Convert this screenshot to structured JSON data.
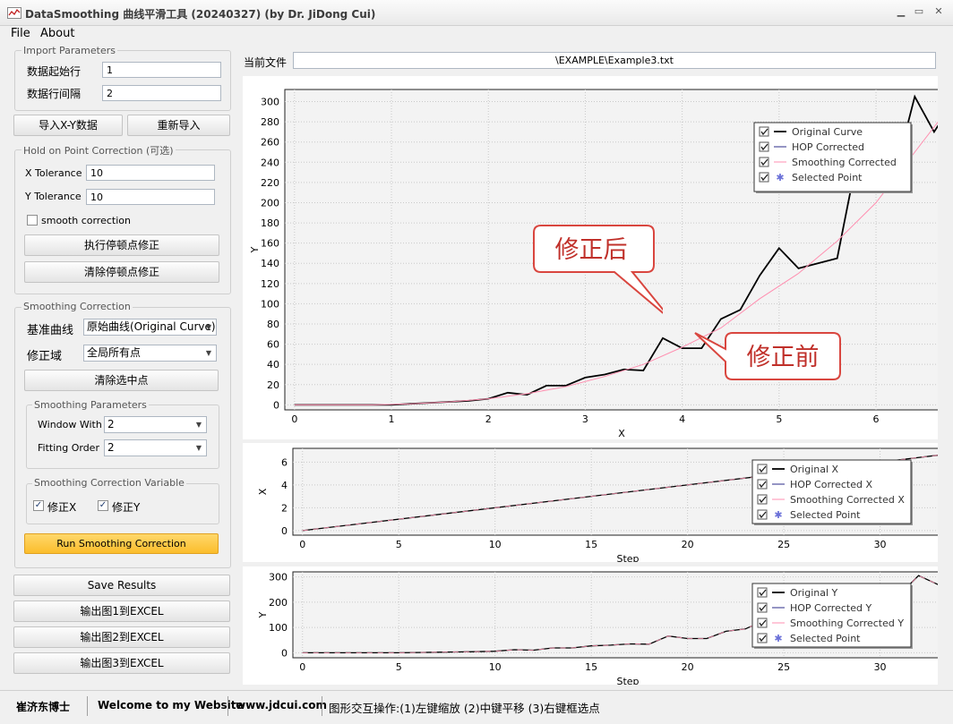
{
  "window": {
    "title": "DataSmoothing 曲线平滑工具 (20240327) (by Dr. JiDong Cui)"
  },
  "menu": [
    "File",
    "About"
  ],
  "import_params": {
    "legend": "Import Parameters",
    "start_row_label": "数据起始行",
    "start_row_value": "1",
    "interval_label": "数据行间隔",
    "interval_value": "2"
  },
  "buttons": {
    "import_xy": "导入X-Y数据",
    "reimport": "重新导入"
  },
  "hold_on": {
    "legend": "Hold on Point Correction (可选)",
    "x_tol_label": "X Tolerance",
    "x_tol_value": "10",
    "y_tol_label": "Y Tolerance",
    "y_tol_value": "10",
    "smooth_label": "smooth correction",
    "smooth_checked": false,
    "exec_button": "执行停顿点修正",
    "clear_button": "清除停顿点修正"
  },
  "smoothing": {
    "legend": "Smoothing Correction",
    "base_label": "基准曲线",
    "base_value": "原始曲线(Original Curve)",
    "domain_label": "修正域",
    "domain_value": "全局所有点",
    "clear_selected": "清除选中点",
    "params_legend": "Smoothing Parameters",
    "window_label": "Window With",
    "window_value": "2",
    "order_label": "Fitting Order",
    "order_value": "2",
    "variable_legend": "Smoothing Correction Variable",
    "fix_x": "修正X",
    "fix_y": "修正Y",
    "run_button": "Run Smoothing Correction"
  },
  "output": {
    "save": "Save Results",
    "out1": "输出图1到EXCEL",
    "out2": "输出图2到EXCEL",
    "out3": "输出图3到EXCEL"
  },
  "current_file": {
    "label": "当前文件",
    "value": "\\EXAMPLE\\Example3.txt"
  },
  "callouts": {
    "after": "修正后",
    "before": "修正前"
  },
  "colors": {
    "original": "#000000",
    "hop": "#2b2b8a",
    "smooth": "#ff8fb0",
    "selected": "#6a70d8",
    "run_button": "#fcc43a"
  },
  "chart_data": [
    {
      "type": "line",
      "xlabel": "X",
      "ylabel": "Y",
      "xlim": [
        -0.1,
        6.85
      ],
      "ylim": [
        -5,
        312
      ],
      "xticks": [
        0,
        1,
        2,
        3,
        4,
        5,
        6
      ],
      "yticks": [
        0,
        20,
        40,
        60,
        80,
        100,
        120,
        140,
        160,
        180,
        200,
        220,
        240,
        260,
        280,
        300
      ],
      "legend": [
        "Original Curve",
        "HOP Corrected",
        "Smoothing Corrected",
        "Selected Point"
      ],
      "series": [
        {
          "name": "Original Curve",
          "x": [
            0,
            0.2,
            0.4,
            0.6,
            0.8,
            1.0,
            1.2,
            1.4,
            1.6,
            1.8,
            2.0,
            2.2,
            2.4,
            2.6,
            2.8,
            3.0,
            3.2,
            3.4,
            3.6,
            3.8,
            4.0,
            4.2,
            4.4,
            4.6,
            4.8,
            5.0,
            5.2,
            5.4,
            5.6,
            5.8,
            6.0,
            6.2,
            6.4,
            6.6,
            6.8
          ],
          "y": [
            0,
            0,
            0,
            0,
            0,
            0,
            1,
            2,
            3,
            4,
            6,
            12,
            10,
            19,
            19,
            27,
            30,
            35,
            34,
            66,
            56,
            56,
            85,
            94,
            128,
            155,
            135,
            140,
            145,
            242,
            241,
            230,
            305,
            270,
            300
          ]
        },
        {
          "name": "Smoothing Corrected",
          "x": [
            0,
            0.4,
            0.8,
            1.2,
            1.6,
            2.0,
            2.4,
            2.8,
            3.2,
            3.6,
            4.0,
            4.4,
            4.8,
            5.2,
            5.6,
            6.0,
            6.4,
            6.8
          ],
          "y": [
            0,
            0,
            0,
            1,
            3,
            6,
            11,
            18,
            28,
            40,
            57,
            76,
            105,
            130,
            162,
            200,
            250,
            300
          ]
        }
      ]
    },
    {
      "type": "line",
      "xlabel": "Step",
      "ylabel": "X",
      "xlim": [
        -0.5,
        34.3
      ],
      "ylim": [
        -0.4,
        7.2
      ],
      "xticks": [
        0,
        5,
        10,
        15,
        20,
        25,
        30
      ],
      "yticks": [
        0,
        2,
        4,
        6
      ],
      "legend": [
        "Original X",
        "HOP Corrected X",
        "Smoothing Corrected X",
        "Selected Point"
      ],
      "series": [
        {
          "name": "Original X",
          "x": [
            0,
            34
          ],
          "y": [
            0,
            6.8
          ]
        }
      ]
    },
    {
      "type": "line",
      "xlabel": "Step",
      "ylabel": "Y",
      "xlim": [
        -0.5,
        34.3
      ],
      "ylim": [
        -20,
        320
      ],
      "xticks": [
        0,
        5,
        10,
        15,
        20,
        25,
        30
      ],
      "yticks": [
        0,
        100,
        200,
        300
      ],
      "legend": [
        "Original Y",
        "HOP Corrected Y",
        "Smoothing Corrected Y",
        "Selected Point"
      ],
      "series": [
        {
          "name": "Original Y",
          "x": [
            0,
            1,
            2,
            3,
            4,
            5,
            6,
            7,
            8,
            9,
            10,
            11,
            12,
            13,
            14,
            15,
            16,
            17,
            18,
            19,
            20,
            21,
            22,
            23,
            24,
            25,
            26,
            27,
            28,
            29,
            30,
            31,
            32,
            33,
            34
          ],
          "y": [
            0,
            0,
            0,
            0,
            0,
            0,
            1,
            2,
            3,
            4,
            6,
            12,
            10,
            19,
            19,
            27,
            30,
            35,
            34,
            66,
            56,
            56,
            85,
            94,
            128,
            155,
            135,
            140,
            145,
            242,
            241,
            230,
            305,
            270,
            300
          ]
        }
      ]
    }
  ],
  "status": {
    "author": "崔济东博士",
    "welcome": "Welcome to my Website",
    "site": "www.jdcui.com",
    "hint": "图形交互操作:(1)左键缩放 (2)中键平移 (3)右键框选点"
  }
}
